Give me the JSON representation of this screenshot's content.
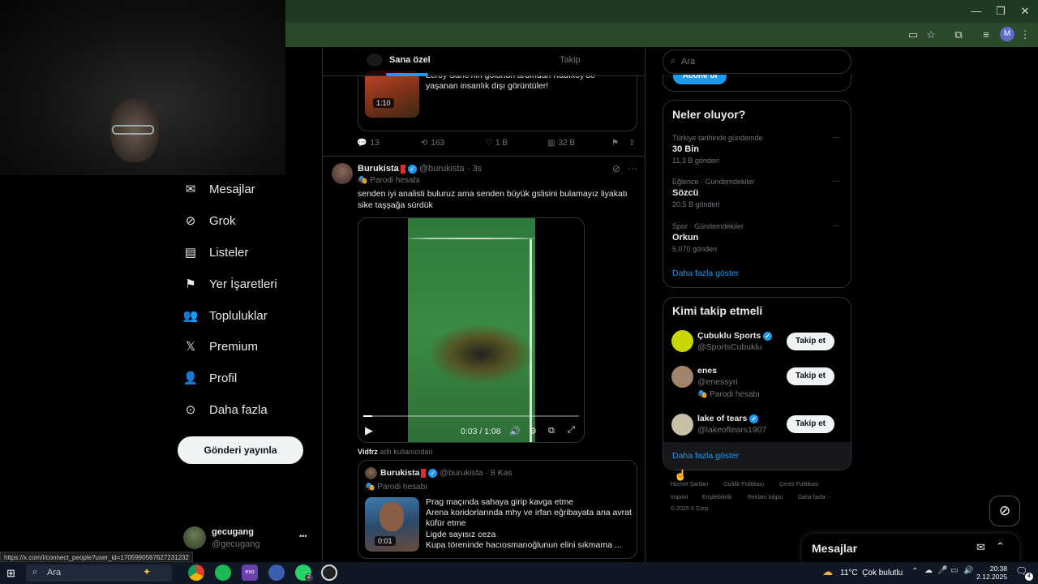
{
  "browser": {
    "window_controls": {
      "minimize": "—",
      "restore": "❐",
      "close": "✕"
    },
    "profile_initial": "M"
  },
  "nav": {
    "items": [
      {
        "label": "Mesajlar",
        "icon": "mail-icon"
      },
      {
        "label": "Grok",
        "icon": "grok-icon"
      },
      {
        "label": "Listeler",
        "icon": "list-icon"
      },
      {
        "label": "Yer İşaretleri",
        "icon": "bookmark-icon"
      },
      {
        "label": "Topluluklar",
        "icon": "communities-icon"
      },
      {
        "label": "Premium",
        "icon": "x-logo-icon"
      },
      {
        "label": "Profil",
        "icon": "profile-icon"
      },
      {
        "label": "Daha fazla",
        "icon": "more-circle-icon"
      }
    ],
    "post_button": "Gönderi yayınla",
    "account": {
      "name": "gecugang",
      "handle": "@gecugang",
      "more": "•••"
    }
  },
  "feed": {
    "tabs": [
      {
        "label": "Sana özel",
        "active": true
      },
      {
        "label": "Takip",
        "active": false
      }
    ],
    "tweet1": {
      "quote_text": "Leroy Sané'nin golünün ardından Kadıköy'de yaşanan insanlık dışı görüntüler!",
      "video_duration": "1:10",
      "replies": "13",
      "retweets": "163",
      "likes": "1 B",
      "views": "32 B"
    },
    "tweet2": {
      "name": "Burukista",
      "handle": "@burukista",
      "time": "3s",
      "parody_label": "Parodi hesabı",
      "text": "senden iyi analisti buluruz ama senden büyük gslisini bulamayız liyakatı sike taşşağa sürdük",
      "video_time": "0:03 / 1:08",
      "video_progress": 0.04,
      "attribution_user": "Vidfrz",
      "attribution_suffix": "adlı kullanıcıdan",
      "quote": {
        "name": "Burukista",
        "handle": "@burukista",
        "date": "8 Kas",
        "parody_label": "Parodi hesabı",
        "lines": [
          "Prag maçında sahaya girip kavga etme",
          "Arena koridorlarında mhy ve irfan eğribayata ana avrat küfür etme",
          "Ligde sayısız ceza",
          "Kupa töreninde hacıosmanoğlunun elini sıkmama ..."
        ],
        "video_duration": "0:01"
      }
    }
  },
  "sidebar": {
    "search_placeholder": "Ara",
    "subscribe_button": "Abone ol",
    "trends": {
      "title": "Neler oluyor?",
      "items": [
        {
          "meta": "Türkiye tarihinde gündemde",
          "name": "30 Bin",
          "count": "11,3 B gönderi"
        },
        {
          "meta": "Eğlence · Gündemdekiler",
          "name": "Sözcü",
          "count": "20,5 B gönderi"
        },
        {
          "meta": "Spor · Gündemdekiler",
          "name": "Orkun",
          "count": "5.070 gönderi"
        }
      ],
      "show_more": "Daha fazla göster"
    },
    "who_to_follow": {
      "title": "Kimi takip etmeli",
      "users": [
        {
          "name": "Çubuklu Sports",
          "handle": "@SportsCubuklu",
          "verified": true,
          "parody": "",
          "button": "Takip et",
          "avatar_color": "#c9d600"
        },
        {
          "name": "enes",
          "handle": "@enessyri",
          "verified": false,
          "parody": "Parodi hesabı",
          "button": "Takip et",
          "avatar_color": "#a0826d"
        },
        {
          "name": "lake of tears",
          "handle": "@lakeoftears1907",
          "verified": true,
          "parody": "",
          "button": "Takip et",
          "avatar_color": "#c8bfa6"
        }
      ],
      "show_more": "Daha fazla göster"
    },
    "footer": {
      "links": [
        "Hizmet Şartları",
        "Gizlilik Politikası",
        "Çerez Politikası",
        "Imprint",
        "Erişilebilirlik",
        "Reklam bilgisi",
        "Daha fazla ···"
      ],
      "copyright": "© 2025 X Corp."
    }
  },
  "messages_drawer": {
    "title": "Mesajlar"
  },
  "status_bar_url": "https://x.com/i/connect_people?user_id=1705990567627231232",
  "taskbar": {
    "search_placeholder": "Ara",
    "weather": "11°C  Çok bulutlu",
    "time": "20:38",
    "date": "2.12.2025",
    "notification_count": "4",
    "whatsapp_badge": "2"
  }
}
